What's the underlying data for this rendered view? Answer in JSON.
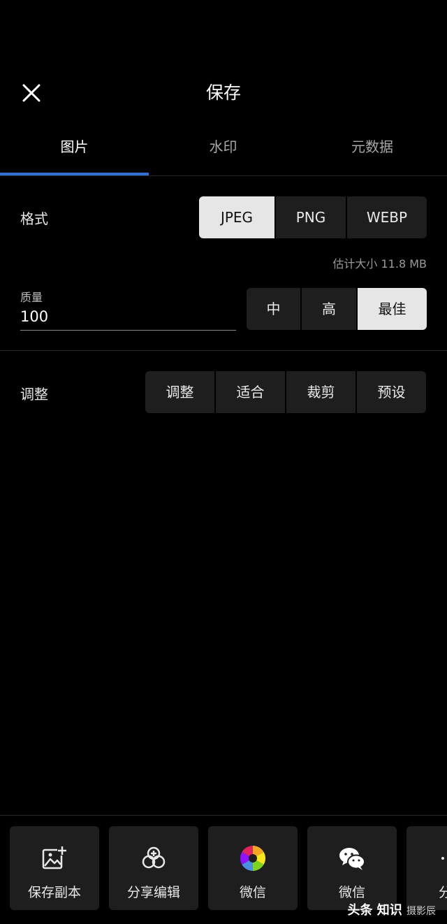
{
  "header": {
    "title": "保存",
    "close_icon": "close-icon"
  },
  "tabs": [
    {
      "label": "图片",
      "active": true
    },
    {
      "label": "水印",
      "active": false
    },
    {
      "label": "元数据",
      "active": false
    }
  ],
  "format": {
    "label": "格式",
    "options": [
      "JPEG",
      "PNG",
      "WEBP"
    ],
    "selected": "JPEG"
  },
  "estimate": "估计大小 11.8 MB",
  "quality": {
    "label": "质量",
    "value": "100",
    "options": [
      "中",
      "高",
      "最佳"
    ],
    "selected": "最佳"
  },
  "adjust": {
    "label": "调整",
    "options": [
      "调整",
      "适合",
      "裁剪",
      "预设"
    ]
  },
  "actions": [
    {
      "label": "保存副本",
      "icon": "add-image-icon"
    },
    {
      "label": "分享编辑",
      "icon": "share-edit-icon"
    },
    {
      "label": "微信",
      "icon": "aperture-icon"
    },
    {
      "label": "微信",
      "icon": "wechat-icon"
    },
    {
      "label": "分",
      "icon": "more-icon"
    }
  ],
  "watermark": {
    "main": "头条 知识",
    "small": "摄影辰"
  },
  "colors": {
    "background": "#000000",
    "accent": "#2f6fd6",
    "button": "#1e1e1e",
    "selected": "#e6e6e6"
  }
}
